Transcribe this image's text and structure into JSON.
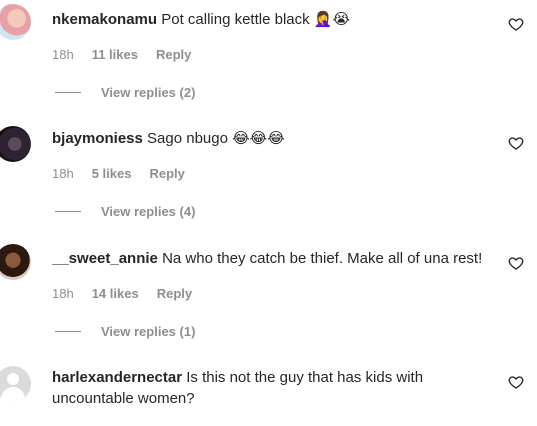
{
  "comments": [
    {
      "username": "nkemakonamu",
      "text": "Pot calling kettle black",
      "emoji": "🤦‍♀️😭",
      "time": "18h",
      "likes": "11 likes",
      "reply_label": "Reply",
      "view_replies": "View replies (2)"
    },
    {
      "username": "bjaymoniess",
      "text": "Sago nbugo",
      "emoji": "😂😂😂",
      "time": "18h",
      "likes": "5 likes",
      "reply_label": "Reply",
      "view_replies": "View replies (4)"
    },
    {
      "username": "__sweet_annie",
      "text": "Na who they catch be thief. Make all of una rest!",
      "emoji": "",
      "time": "18h",
      "likes": "14 likes",
      "reply_label": "Reply",
      "view_replies": "View replies (1)"
    },
    {
      "username": "harlexandernectar",
      "text": "Is this not the guy that has kids with uncountable women?",
      "emoji": ""
    }
  ]
}
